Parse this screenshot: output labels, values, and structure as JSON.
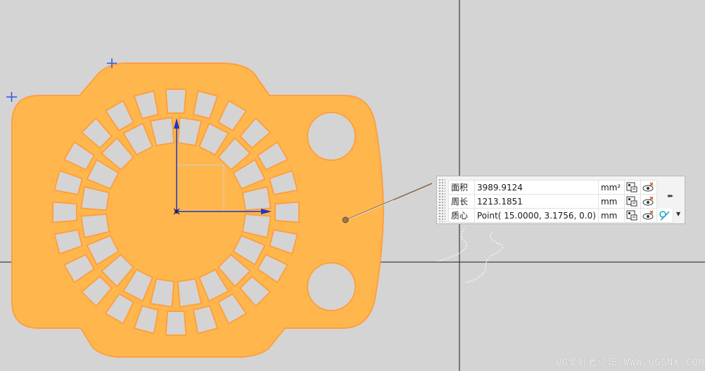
{
  "colors": {
    "background": "#d4d4d4",
    "part_fill": "#ffb74d",
    "part_edge": "#ff9f40",
    "axis": "#1f35c9",
    "leader_line": "#8b6a45"
  },
  "measure_panel": {
    "rows": [
      {
        "label": "面积",
        "value": "3989.9124",
        "unit": "mm²",
        "icons": [
          "export-icon",
          "visibility-icon"
        ]
      },
      {
        "label": "周长",
        "value": "1213.1851",
        "unit": "mm",
        "icons": [
          "export-icon",
          "visibility-icon"
        ]
      },
      {
        "label": "质心",
        "value": "Point( 15.0000, 3.1756, 0.0)",
        "unit": "mm",
        "icons": [
          "export-icon",
          "visibility-icon",
          "create-point-icon"
        ]
      }
    ],
    "more_glyph": "▸▸▸",
    "dropdown_glyph": "▼"
  },
  "watermark": "UG爱好者论坛 WWW.UGSNX.COM"
}
